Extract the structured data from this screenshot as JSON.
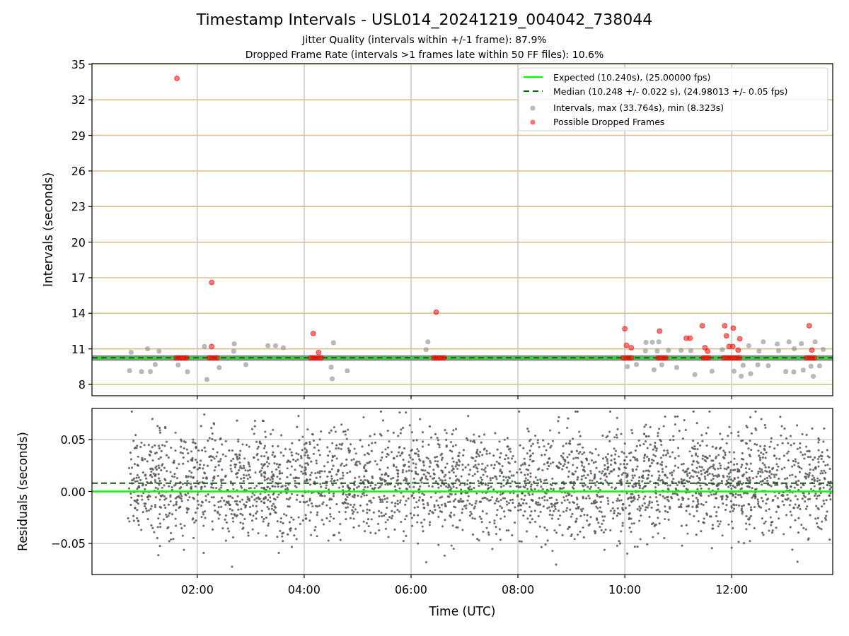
{
  "figure": {
    "title": "Timestamp Intervals - USL014_20241219_004042_738044",
    "subtitles": [
      "Jitter Quality (intervals within +/-1 frame): 87.9%",
      "Dropped Frame Rate (intervals >1 frames late within 50 FF files): 10.6%"
    ]
  },
  "interval_chart": {
    "chart_data": {
      "type": "scatter",
      "grid": true,
      "legend": "upper right",
      "bands": [
        {
          "axis": "y",
          "from": 10.0,
          "to": 10.46,
          "color": "#808080"
        }
      ],
      "ylabel": "Intervals (seconds)",
      "xlim": [
        0.03,
        13.89
      ],
      "ylim": [
        7.05,
        35.05
      ],
      "yticks": [
        {
          "value": 8,
          "label": "8"
        },
        {
          "value": 11,
          "label": "11"
        },
        {
          "value": 14,
          "label": "14"
        },
        {
          "value": 17,
          "label": "17"
        },
        {
          "value": 20,
          "label": "20"
        },
        {
          "value": 23,
          "label": "23"
        },
        {
          "value": 26,
          "label": "26"
        },
        {
          "value": 29,
          "label": "29"
        },
        {
          "value": 32,
          "label": "32"
        },
        {
          "value": 35,
          "label": "35"
        }
      ],
      "series": [
        {
          "name": "Expected (10.240s), (25.00000 fps)",
          "type": "line",
          "color": "#00ff00",
          "x": [
            0.03,
            13.89
          ],
          "values": [
            10.24,
            10.24
          ]
        },
        {
          "name": "Median (10.248 +/- 0.022 s), (24.98013 +/- 0.05 fps)",
          "type": "line",
          "line_style": "dashed",
          "color": "#006400",
          "x": [
            0.03,
            13.89
          ],
          "values": [
            10.25,
            10.25
          ]
        },
        {
          "name": "Intervals, max (33.764s), min (8.323s)",
          "color": "#808080"
        },
        {
          "name": "Possible Dropped Frames",
          "color": "#ff0000",
          "x": [
            1.62,
            2.27,
            2.27,
            4.17,
            4.27,
            6.47,
            10.0,
            10.03,
            10.12,
            10.65,
            11.15,
            11.22,
            11.45,
            11.5,
            11.55,
            11.87,
            11.9,
            11.95,
            12.02,
            12.03,
            12.12,
            12.15,
            13.45,
            13.5,
            1.6,
            1.65,
            1.7,
            1.75,
            1.8,
            2.22,
            2.27,
            2.32,
            2.37,
            4.12,
            4.17,
            4.22,
            4.27,
            4.32,
            6.42,
            6.47,
            6.52,
            6.57,
            6.62,
            9.97,
            10.02,
            10.07,
            10.12,
            10.62,
            10.67,
            10.72,
            10.77,
            11.47,
            11.52,
            11.57,
            11.85,
            11.9,
            11.95,
            12.0,
            12.05,
            12.1,
            12.15,
            13.4,
            13.45,
            13.5,
            13.55
          ],
          "values": [
            33.8,
            16.6,
            11.2,
            12.3,
            10.7,
            14.1,
            12.7,
            11.3,
            11.1,
            12.5,
            11.9,
            11.9,
            12.95,
            11.1,
            10.8,
            12.95,
            12.1,
            11.2,
            11.2,
            12.75,
            10.9,
            11.85,
            12.95,
            10.9,
            10.24,
            10.24,
            10.24,
            10.24,
            10.24,
            10.24,
            10.24,
            10.24,
            10.24,
            10.24,
            10.24,
            10.24,
            10.24,
            10.24,
            10.24,
            10.24,
            10.24,
            10.24,
            10.24,
            10.24,
            10.24,
            10.24,
            10.24,
            10.24,
            10.24,
            10.24,
            10.24,
            10.24,
            10.24,
            10.24,
            10.24,
            10.24,
            10.24,
            10.24,
            10.24,
            10.24,
            10.24,
            10.24,
            10.24,
            10.24,
            10.24
          ]
        }
      ]
    }
  },
  "residual_chart": {
    "chart_data": {
      "type": "scatter",
      "grid": true,
      "xlabel": "Time (UTC)",
      "ylabel": "Residuals (seconds)",
      "xlim": [
        0.03,
        13.89
      ],
      "ylim": [
        -0.08,
        0.08
      ],
      "xticks": [
        {
          "value": 2,
          "label": "02:00"
        },
        {
          "value": 4,
          "label": "04:00"
        },
        {
          "value": 6,
          "label": "06:00"
        },
        {
          "value": 8,
          "label": "08:00"
        },
        {
          "value": 10,
          "label": "10:00"
        },
        {
          "value": 12,
          "label": "12:00"
        }
      ],
      "yticks": [
        {
          "value": 0.05,
          "label": "0.05"
        },
        {
          "value": 0,
          "label": "0.00"
        },
        {
          "value": -0.05,
          "label": "−0.05"
        }
      ],
      "ref_lines": [
        {
          "axis": "y",
          "value": 0.008,
          "line_style": "dashed",
          "color": "#006400"
        },
        {
          "axis": "y",
          "value": 0,
          "color": "#00ff00"
        }
      ]
    }
  }
}
